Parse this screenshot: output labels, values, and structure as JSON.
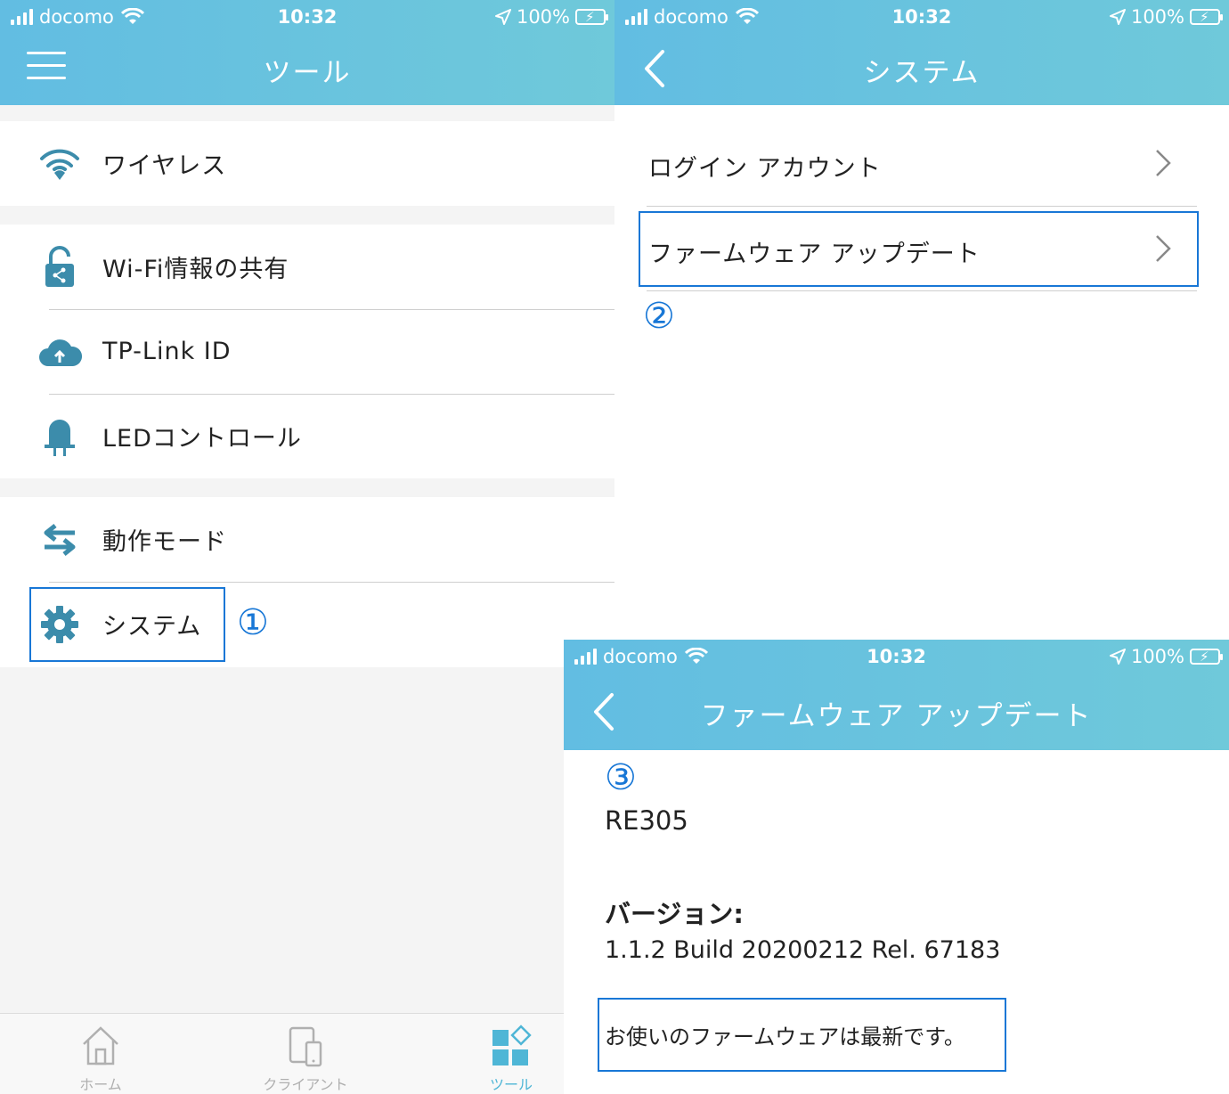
{
  "status": {
    "carrier": "docomo",
    "time": "10:32",
    "battery": "100%"
  },
  "panel1": {
    "title": "ツール",
    "items": [
      {
        "label": "ワイヤレス"
      },
      {
        "label": "Wi-Fi情報の共有"
      },
      {
        "label": "TP-Link ID"
      },
      {
        "label": "LEDコントロール"
      },
      {
        "label": "動作モード"
      },
      {
        "label": "システム"
      }
    ],
    "marker": "①",
    "tabs": [
      {
        "label": "ホーム"
      },
      {
        "label": "クライアント"
      },
      {
        "label": "ツール"
      }
    ]
  },
  "panel2": {
    "title": "システム",
    "items": [
      {
        "label": "ログイン アカウント"
      },
      {
        "label": "ファームウェア アップデート"
      }
    ],
    "marker": "②"
  },
  "panel3": {
    "title": "ファームウェア アップデート",
    "marker": "③",
    "model": "RE305",
    "version_label": "バージョン:",
    "version_value": "1.1.2 Build 20200212 Rel. 67183",
    "message": "お使いのファームウェアは最新です。"
  },
  "colors": {
    "header": "#62bde2",
    "icon": "#3c8cab",
    "highlight": "#1877d6",
    "active_tab": "#4fb6d6"
  }
}
